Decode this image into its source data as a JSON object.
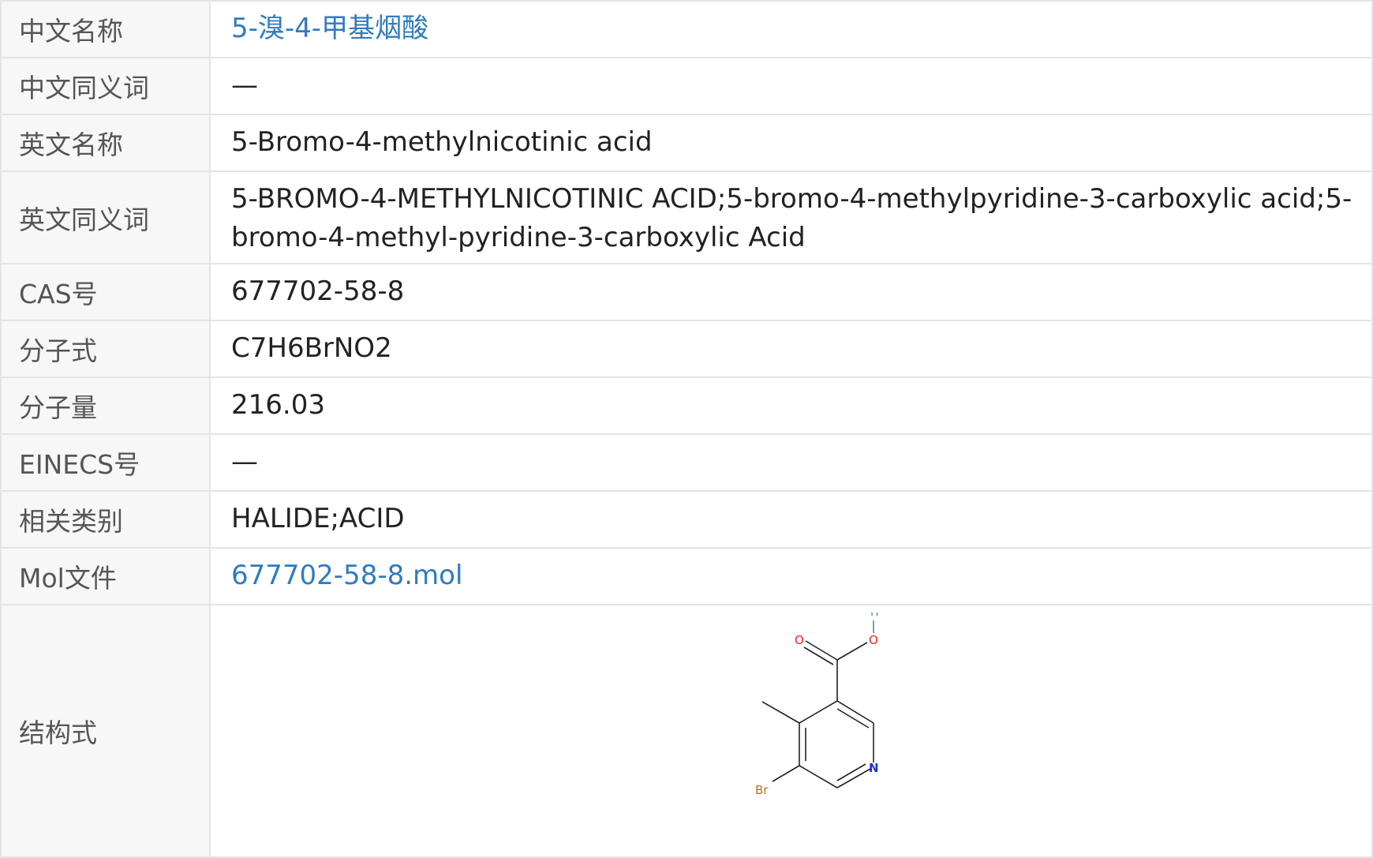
{
  "rows": [
    {
      "label": "中文名称",
      "value": "5-溴-4-甲基烟酸",
      "link": true
    },
    {
      "label": "中文同义词",
      "value": "—",
      "link": false
    },
    {
      "label": "英文名称",
      "value": "5-Bromo-4-methylnicotinic acid",
      "link": false
    },
    {
      "label": "英文同义词",
      "value": "5-BROMO-4-METHYLNICOTINIC ACID;5-bromo-4-methylpyridine-3-carboxylic acid;5-bromo-4-methyl-pyridine-3-carboxylic Acid",
      "link": false
    },
    {
      "label": "CAS号",
      "value": "677702-58-8",
      "link": false
    },
    {
      "label": "分子式",
      "value": "C7H6BrNO2",
      "link": false
    },
    {
      "label": "分子量",
      "value": "216.03",
      "link": false
    },
    {
      "label": "EINECS号",
      "value": "—",
      "link": false
    },
    {
      "label": "相关类别",
      "value": "HALIDE;ACID",
      "link": false
    },
    {
      "label": "Mol文件",
      "value": "677702-58-8.mol",
      "link": true
    },
    {
      "label": "结构式",
      "value": "",
      "link": false
    }
  ],
  "structure": {
    "atoms": [
      "H",
      "O",
      "O",
      "N",
      "Br"
    ]
  },
  "colors": {
    "link": "#2f7bbf",
    "label_bg": "#f7f7f7",
    "border": "#e4e4e4",
    "oxygen": "#e8221f",
    "nitrogen": "#1e2fd6",
    "bromine": "#b5702a",
    "hydrogen": "#5a8a8a"
  }
}
